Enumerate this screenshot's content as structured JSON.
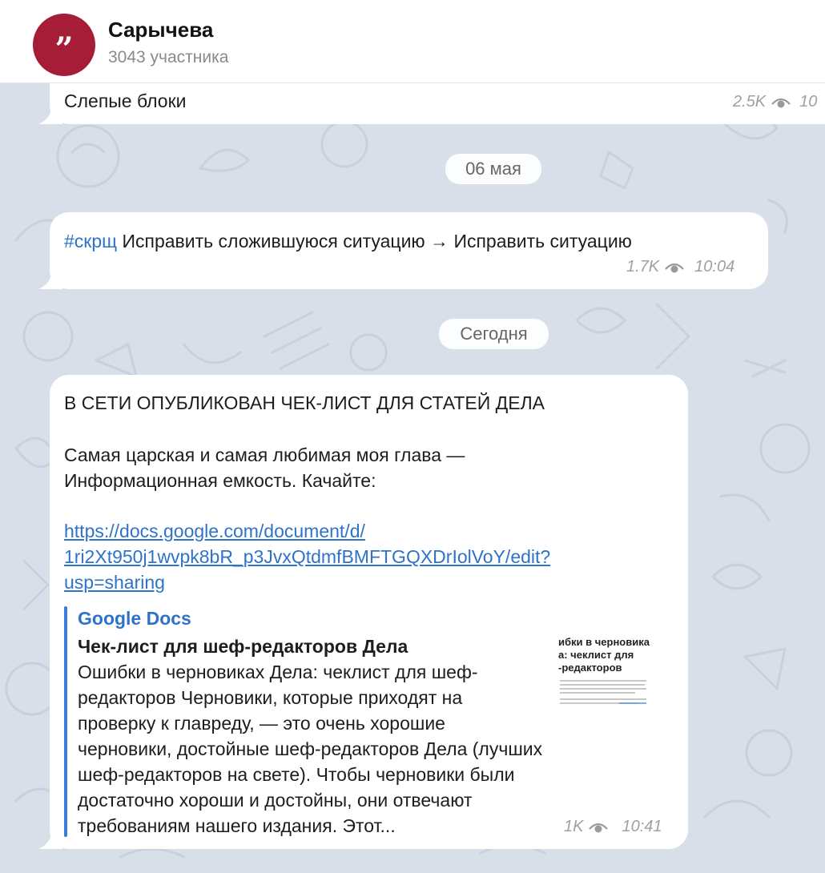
{
  "chat": {
    "title": "Сарычева",
    "subtitle": "3043 участника",
    "avatar_glyph": "”"
  },
  "messages": [
    {
      "text": "Слепые блоки",
      "views": "2.5K",
      "time": "10"
    },
    {
      "hashtag": "#скрщ",
      "text": " Исправить сложившуюся ситуацию → Исправить ситуацию",
      "views": "1.7K",
      "time": "10:04"
    },
    {
      "lines": [
        "В СЕТИ ОПУБЛИКОВАН ЧЕК-ЛИСТ ДЛЯ СТАТЕЙ ДЕЛА",
        "Самая царская и самая любимая моя глава —",
        "Информационная емкость. Качайте:"
      ],
      "link_lines": [
        "https://docs.google.com/document/d/",
        "1ri2Xt950j1wvpk8bR_p3JvxQtdmfBMFTGQXDrIolVoY/edit?",
        "usp=sharing"
      ],
      "preview": {
        "site": "Google Docs",
        "title": "Чек-лист для шеф-редакторов Дела",
        "description_lines": [
          "Ошибки в черновиках Дела: чеклист для шеф-",
          "редакторов Черновики, которые приходят на",
          "проверку к главреду, — это очень хорошие",
          "черновики, достойные шеф-редакторов Дела (лучших",
          "шеф-редакторов на свете). Чтобы черновики были",
          "достаточно хороши и достойны, они отвечают",
          "требованиям нашего издания.  Этот..."
        ],
        "thumb_lines": [
          "ибки в черновиках",
          "а: чеклист для",
          "-редакторов"
        ]
      },
      "views": "1K",
      "time": "10:41"
    }
  ],
  "date_separators": [
    "06 мая",
    "Сегодня"
  ],
  "colors": {
    "avatar": "#a51d36",
    "link": "#2e73c7",
    "preview_bar": "#3b7dd8",
    "background": "#d9dfe8"
  }
}
